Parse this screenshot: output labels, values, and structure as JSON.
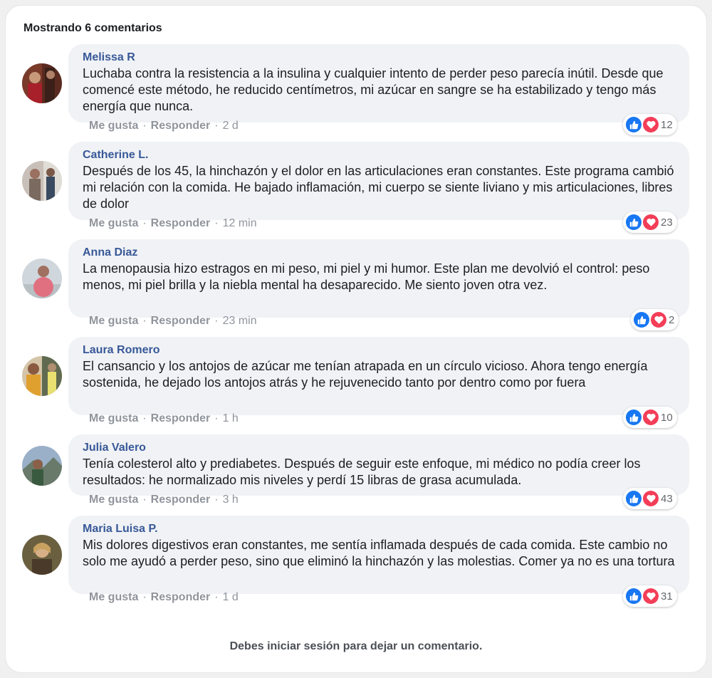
{
  "header": {
    "count_label": "Mostrando 6 comentarios"
  },
  "actions": {
    "like": "Me gusta",
    "reply": "Responder",
    "separator": "·"
  },
  "comments": [
    {
      "author": "Melissa R",
      "text": "Luchaba contra la resistencia a la insulina y cualquier intento de perder peso parecía inútil. Desde que comencé este método, he reducido centímetros, mi azúcar en sangre se ha estabilizado y tengo más energía que nunca.",
      "time": "2 d",
      "reactions": "12"
    },
    {
      "author": "Catherine L.",
      "text": "Después de los 45, la hinchazón y el dolor en las articulaciones eran constantes. Este programa cambió mi relación con la comida. He bajado inflamación, mi cuerpo se siente liviano y mis articulaciones, libres de dolor",
      "time": "12 min",
      "reactions": "23"
    },
    {
      "author": "Anna Diaz",
      "text": "La menopausia hizo estragos en mi peso, mi piel y mi humor. Este plan me devolvió el control: peso menos, mi piel brilla y la niebla mental ha desaparecido. Me siento joven otra vez.",
      "time": "23 min",
      "reactions": "2"
    },
    {
      "author": "Laura Romero",
      "text": "El cansancio y los antojos de azúcar me tenían atrapada en un círculo vicioso. Ahora tengo energía sostenida, he dejado los antojos atrás y he rejuvenecido tanto por dentro como por fuera",
      "time": "1 h",
      "reactions": "10"
    },
    {
      "author": "Julia Valero",
      "text": "Tenía colesterol alto y prediabetes. Después de seguir este enfoque, mi médico no podía creer los resultados: he normalizado mis niveles y perdí 15 libras de grasa acumulada.",
      "time": "3 h",
      "reactions": "43"
    },
    {
      "author": "Maria Luisa P.",
      "text": "Mis dolores digestivos eran constantes, me sentía inflamada después de cada comida. Este cambio no solo me ayudó a perder peso, sino que eliminó la hinchazón y las molestias. Comer ya no es una tortura",
      "time": "1 d",
      "reactions": "31"
    }
  ],
  "footer": {
    "login_notice": "Debes iniciar sesión para dejar un comentario."
  },
  "colors": {
    "author": "#385898",
    "like": "#1877f2",
    "love": "#f33e58",
    "bubble": "#f0f2f5"
  }
}
